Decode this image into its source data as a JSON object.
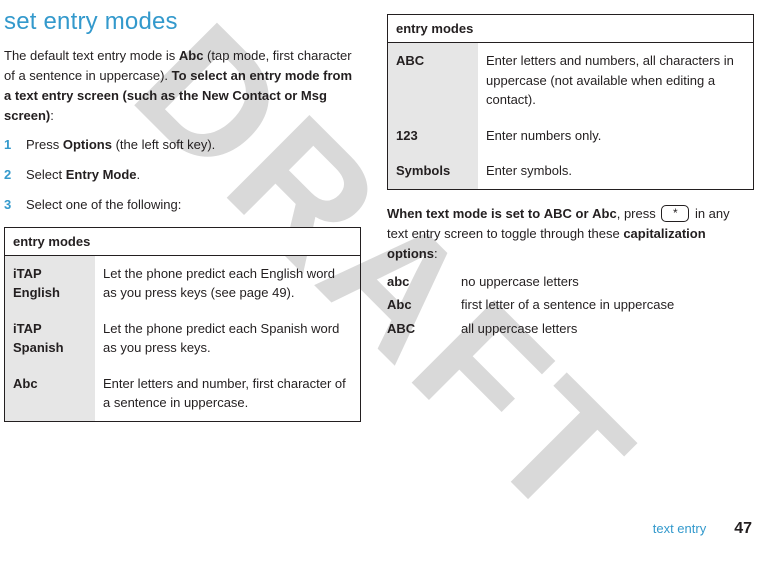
{
  "watermark": "DRAFT",
  "heading": "set entry modes",
  "intro": {
    "pre": "The default text entry mode is ",
    "mode": "Abc",
    "mid": " (tap mode, first character of a sentence in uppercase). ",
    "bold": "To select an entry mode from a text entry screen (such as the New Contact or Msg screen)",
    "post": ":"
  },
  "steps": [
    {
      "n": "1",
      "pre": "Press ",
      "key": "Options",
      "post": " (the left soft key)."
    },
    {
      "n": "2",
      "pre": "Select ",
      "key": "Entry Mode",
      "post": "."
    },
    {
      "n": "3",
      "pre": "Select one of the following:",
      "key": "",
      "post": ""
    }
  ],
  "table_header": "entry modes",
  "modes_left": [
    {
      "name": "iTAP English",
      "desc": "Let the phone predict each English word as you press keys (see page 49)."
    },
    {
      "name": "iTAP Spanish",
      "desc": "Let the phone predict each Spanish word as you press keys."
    },
    {
      "name": "Abc",
      "desc": "Enter letters and number, first character of a sentence in uppercase."
    }
  ],
  "modes_right": [
    {
      "name": "ABC",
      "desc": "Enter letters and numbers, all characters in uppercase (not available when editing a contact)."
    },
    {
      "name": "123",
      "desc": "Enter numbers only."
    },
    {
      "name": "Symbols",
      "desc": "Enter symbols."
    }
  ],
  "para2": {
    "a": "When text mode is set to ",
    "b": "ABC",
    "c": " or ",
    "d": "Abc",
    "e": ", press ",
    "key": "*",
    "f": " in any text entry screen to toggle through these ",
    "g": "capitalization options",
    "h": ":"
  },
  "caps": [
    {
      "m": "abc",
      "d": "no uppercase letters"
    },
    {
      "m": "Abc",
      "d": "first letter of a sentence in uppercase"
    },
    {
      "m": "ABC",
      "d": "all uppercase letters"
    }
  ],
  "footer": {
    "section": "text entry",
    "page": "47"
  }
}
